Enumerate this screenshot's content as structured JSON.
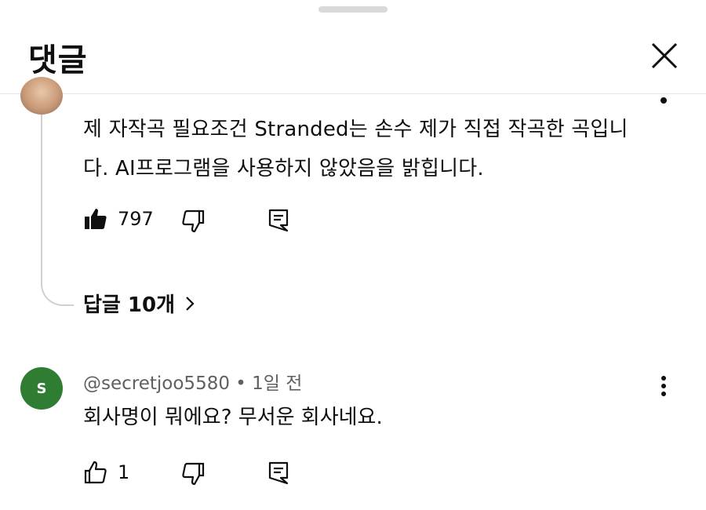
{
  "header": {
    "title": "댓글"
  },
  "comment1": {
    "text": "제 자작곡 필요조건 Stranded는 손수 제가 직접 작곡한 곡입니다. AI프로그램을 사용하지 않았음을 밝힙니다.",
    "likes": "797",
    "replies_label": "답글 10개"
  },
  "comment2": {
    "avatar_letter": "S",
    "author": "@secretjoo5580",
    "time": "1일 전",
    "text": "회사명이 뭐에요? 무서운 회사네요.",
    "likes": "1"
  },
  "colors": {
    "avatar_green": "#2e7d32",
    "meta_gray": "#606060"
  }
}
